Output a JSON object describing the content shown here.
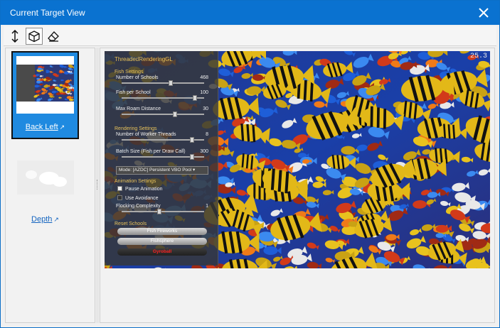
{
  "window": {
    "title": "Current Target View"
  },
  "toolbar": {
    "buttons": [
      {
        "icon": "vertical-arrows-icon",
        "active": false
      },
      {
        "icon": "cube-icon",
        "active": true
      },
      {
        "icon": "eraser-icon",
        "active": false
      }
    ]
  },
  "sidebar": {
    "items": [
      {
        "label": "Back Left",
        "selected": true
      },
      {
        "label": "Depth",
        "selected": false
      }
    ]
  },
  "render": {
    "fps": "25.3",
    "panel": {
      "title": "ThreadedRenderingGL",
      "fish_settings": {
        "header": "Fish Settings",
        "sliders": [
          {
            "label": "Number of Schools",
            "value": "468",
            "fraction": 0.6
          },
          {
            "label": "Fish per School",
            "value": "100",
            "fraction": 0.42
          },
          {
            "label": "Max Roam Distance",
            "value": "30",
            "fraction": 0.35
          }
        ]
      },
      "rendering_settings": {
        "header": "Rendering Settings",
        "sliders": [
          {
            "label": "Number of Worker Threads",
            "value": "8",
            "fraction": 0.4
          },
          {
            "label": "Batch Size (Fish per Draw Call)",
            "value": "300",
            "fraction": 0.5
          }
        ],
        "mode": "Mode: [AZDC] Persistent VBO Pool"
      },
      "animation_settings": {
        "header": "Animation Settings",
        "checkboxes": [
          {
            "label": "Pause Animation",
            "checked": false
          },
          {
            "label": "Use Avoidance",
            "checked": true
          }
        ],
        "flocking_label": "Flocking Complexity",
        "flocking_value": "1",
        "flocking_fraction": 0.1
      },
      "reset_schools": {
        "header": "Reset Schools",
        "buttons": [
          "Fish Fireworks",
          "Fishsphere",
          "Gyroball"
        ]
      }
    }
  },
  "colors": {
    "accent": "#0a72d0",
    "link": "#1565c0",
    "selected_bg": "#1f8ae0",
    "panel_text": "#e8c25a"
  }
}
